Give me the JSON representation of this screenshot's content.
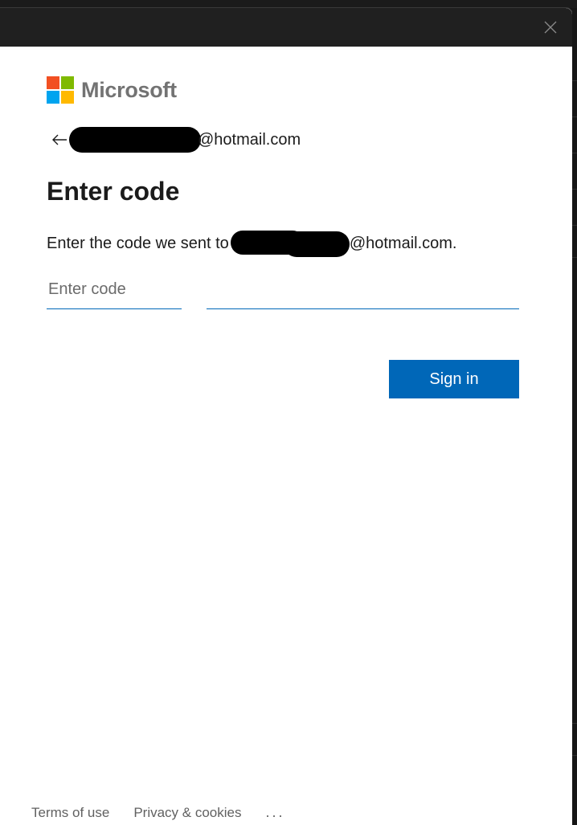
{
  "brand": {
    "name": "Microsoft",
    "colors": [
      "#f25022",
      "#7fba00",
      "#00a4ef",
      "#ffb900"
    ]
  },
  "titlebar": {
    "close_icon": "close-icon"
  },
  "identity": {
    "back_icon": "back-arrow-icon",
    "email_suffix": "@hotmail.com"
  },
  "page": {
    "title": "Enter code",
    "description_prefix": "Enter the code we sent to",
    "description_suffix": "@hotmail.com."
  },
  "form": {
    "code_placeholder": "Enter code",
    "code_value": "",
    "submit_label": "Sign in"
  },
  "footer": {
    "terms": "Terms of use",
    "privacy": "Privacy & cookies",
    "more": "..."
  },
  "accent": "#0067b8"
}
